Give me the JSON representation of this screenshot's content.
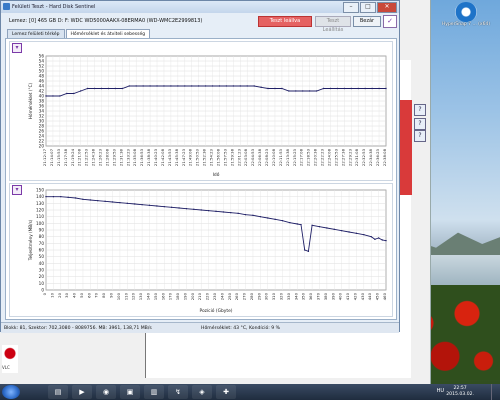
{
  "window": {
    "title": "Felületi Teszt - Hard Disk Sentinel"
  },
  "drive": {
    "label": "Lemez:",
    "value": "[0] 465 GB D: F: WDC WD5000AAKX-08ERMA0 (WD-WMC2E2999813)"
  },
  "buttons": {
    "status": "Teszt leállva",
    "grey": "Teszt Leállítás",
    "close": "Bezár"
  },
  "tabs": [
    {
      "label": "Lemez felületi térkép",
      "active": false
    },
    {
      "label": "Hőmérséklet és átviteli sebesség",
      "active": true
    }
  ],
  "chart_data": [
    {
      "type": "line",
      "title": "",
      "xlabel": "Idő",
      "ylabel": "Hőmérséklet (°C)",
      "ylim": [
        20,
        56
      ],
      "yticks": [
        20,
        22,
        24,
        26,
        28,
        30,
        32,
        34,
        36,
        38,
        40,
        42,
        44,
        46,
        48,
        50,
        52,
        54,
        56
      ],
      "grid": true,
      "color": "#1f1f66",
      "x": [
        "21:12:17",
        "21:14:07",
        "21:15:53",
        "21:17:38",
        "21:19:23",
        "21:21:08",
        "21:22:53",
        "21:24:38",
        "21:26:23",
        "21:28:08",
        "21:29:53",
        "21:31:38",
        "21:33:23",
        "21:35:08",
        "21:36:53",
        "21:38:38",
        "21:40:23",
        "21:42:08",
        "21:43:53",
        "21:45:38",
        "21:47:23",
        "21:49:08",
        "21:50:53",
        "21:52:38",
        "21:54:23",
        "21:56:08",
        "21:57:53",
        "21:59:38",
        "22:01:23",
        "22:03:08",
        "22:04:53",
        "22:06:38",
        "22:08:23",
        "22:10:08",
        "22:11:53",
        "22:13:38",
        "22:15:23",
        "22:17:08",
        "22:18:53",
        "22:20:38",
        "22:22:23",
        "22:24:08",
        "22:25:53",
        "22:27:38",
        "22:29:23",
        "22:31:08",
        "22:32:53",
        "22:34:38",
        "22:36:23",
        "22:38:08"
      ],
      "xtick_labels": [
        "21:12:17",
        "21:14:07",
        "21:15:53",
        "21:17:38",
        "21:19:24",
        "21:21:08",
        "21:22:53",
        "21:24:38",
        "21:26:23",
        "21:28:08",
        "21:29:53",
        "21:31:38",
        "21:33:23",
        "21:35:08",
        "21:36:53",
        "21:38:38",
        "21:40:23",
        "21:42:08",
        "21:43:53",
        "21:45:38",
        "21:47:23",
        "21:49:08",
        "21:50:53",
        "21:52:38",
        "21:54:23",
        "21:56:08",
        "21:57:53",
        "21:59:38",
        "22:01:23",
        "22:03:08",
        "22:04:53",
        "22:06:38",
        "22:08:23",
        "22:10:08",
        "22:11:53",
        "22:13:38",
        "22:15:23",
        "22:17:08",
        "22:18:53",
        "22:20:38",
        "22:22:23",
        "22:24:08",
        "22:25:53",
        "22:27:38",
        "22:29:23",
        "22:31:08",
        "22:32:53",
        "22:34:38",
        "22:36:23",
        "22:38:08"
      ],
      "values": [
        40,
        40,
        40,
        41,
        41,
        42,
        43,
        43,
        43,
        43,
        43,
        43,
        44,
        44,
        44,
        44,
        44,
        44,
        44,
        44,
        44,
        44,
        44,
        44,
        44,
        44,
        44,
        44,
        44,
        44,
        44,
        43.5,
        43,
        43,
        43,
        42,
        42,
        42,
        42,
        42,
        43,
        43,
        43,
        43,
        43,
        43,
        43,
        43,
        43,
        43
      ]
    },
    {
      "type": "line",
      "title": "",
      "xlabel": "Pozíció (Gbyte)",
      "ylabel": "Teljesítmény (MB/s)",
      "ylim": [
        0,
        150
      ],
      "yticks": [
        0,
        10,
        20,
        30,
        40,
        50,
        60,
        70,
        80,
        90,
        100,
        110,
        120,
        130,
        140,
        150
      ],
      "grid": true,
      "color": "#1f1f66",
      "xtick_labels": [
        "0",
        "10",
        "20",
        "30",
        "40",
        "50",
        "60",
        "70",
        "80",
        "90",
        "100",
        "110",
        "120",
        "130",
        "140",
        "150",
        "160",
        "170",
        "180",
        "190",
        "200",
        "210",
        "220",
        "230",
        "240",
        "250",
        "260",
        "270",
        "280",
        "290",
        "300",
        "310",
        "320",
        "330",
        "340",
        "350",
        "360",
        "370",
        "380",
        "390",
        "400",
        "410",
        "420",
        "430",
        "440",
        "450",
        "460"
      ],
      "x": [
        0,
        10,
        20,
        30,
        40,
        50,
        60,
        70,
        80,
        90,
        100,
        110,
        120,
        130,
        140,
        150,
        160,
        170,
        180,
        190,
        200,
        210,
        220,
        230,
        240,
        250,
        260,
        270,
        280,
        290,
        300,
        310,
        320,
        330,
        340,
        345,
        350,
        355,
        360,
        370,
        380,
        390,
        400,
        410,
        420,
        430,
        440,
        445,
        450,
        455,
        460
      ],
      "values": [
        140,
        140,
        140,
        139,
        138,
        136,
        135,
        134,
        133,
        132,
        131,
        130,
        129,
        128,
        127,
        126,
        125,
        124,
        123,
        122,
        121,
        120,
        119,
        118,
        117,
        116,
        115,
        113,
        112,
        110,
        108,
        106,
        104,
        101,
        99,
        98,
        60,
        58,
        97,
        95,
        93,
        91,
        89,
        87,
        85,
        83,
        80,
        76,
        78,
        75,
        74
      ]
    }
  ],
  "status": {
    "left": "Blokk: 81, Szektor: 702,3080 - 8089756. MB: 3961, 138,71 MB/s",
    "right": "Hőmérséklet: 43 °C, Kondíció: 9 %"
  },
  "desktop_icon": {
    "label": "HyperSnap 7 ... (x64)"
  },
  "taskbar": {
    "time": "22:57",
    "date": "2015.03.02.",
    "tray_lang": "HU"
  },
  "colors": {
    "status_button": "#e56262",
    "series": "#1f1f66",
    "accent": "#7b3aa8"
  }
}
